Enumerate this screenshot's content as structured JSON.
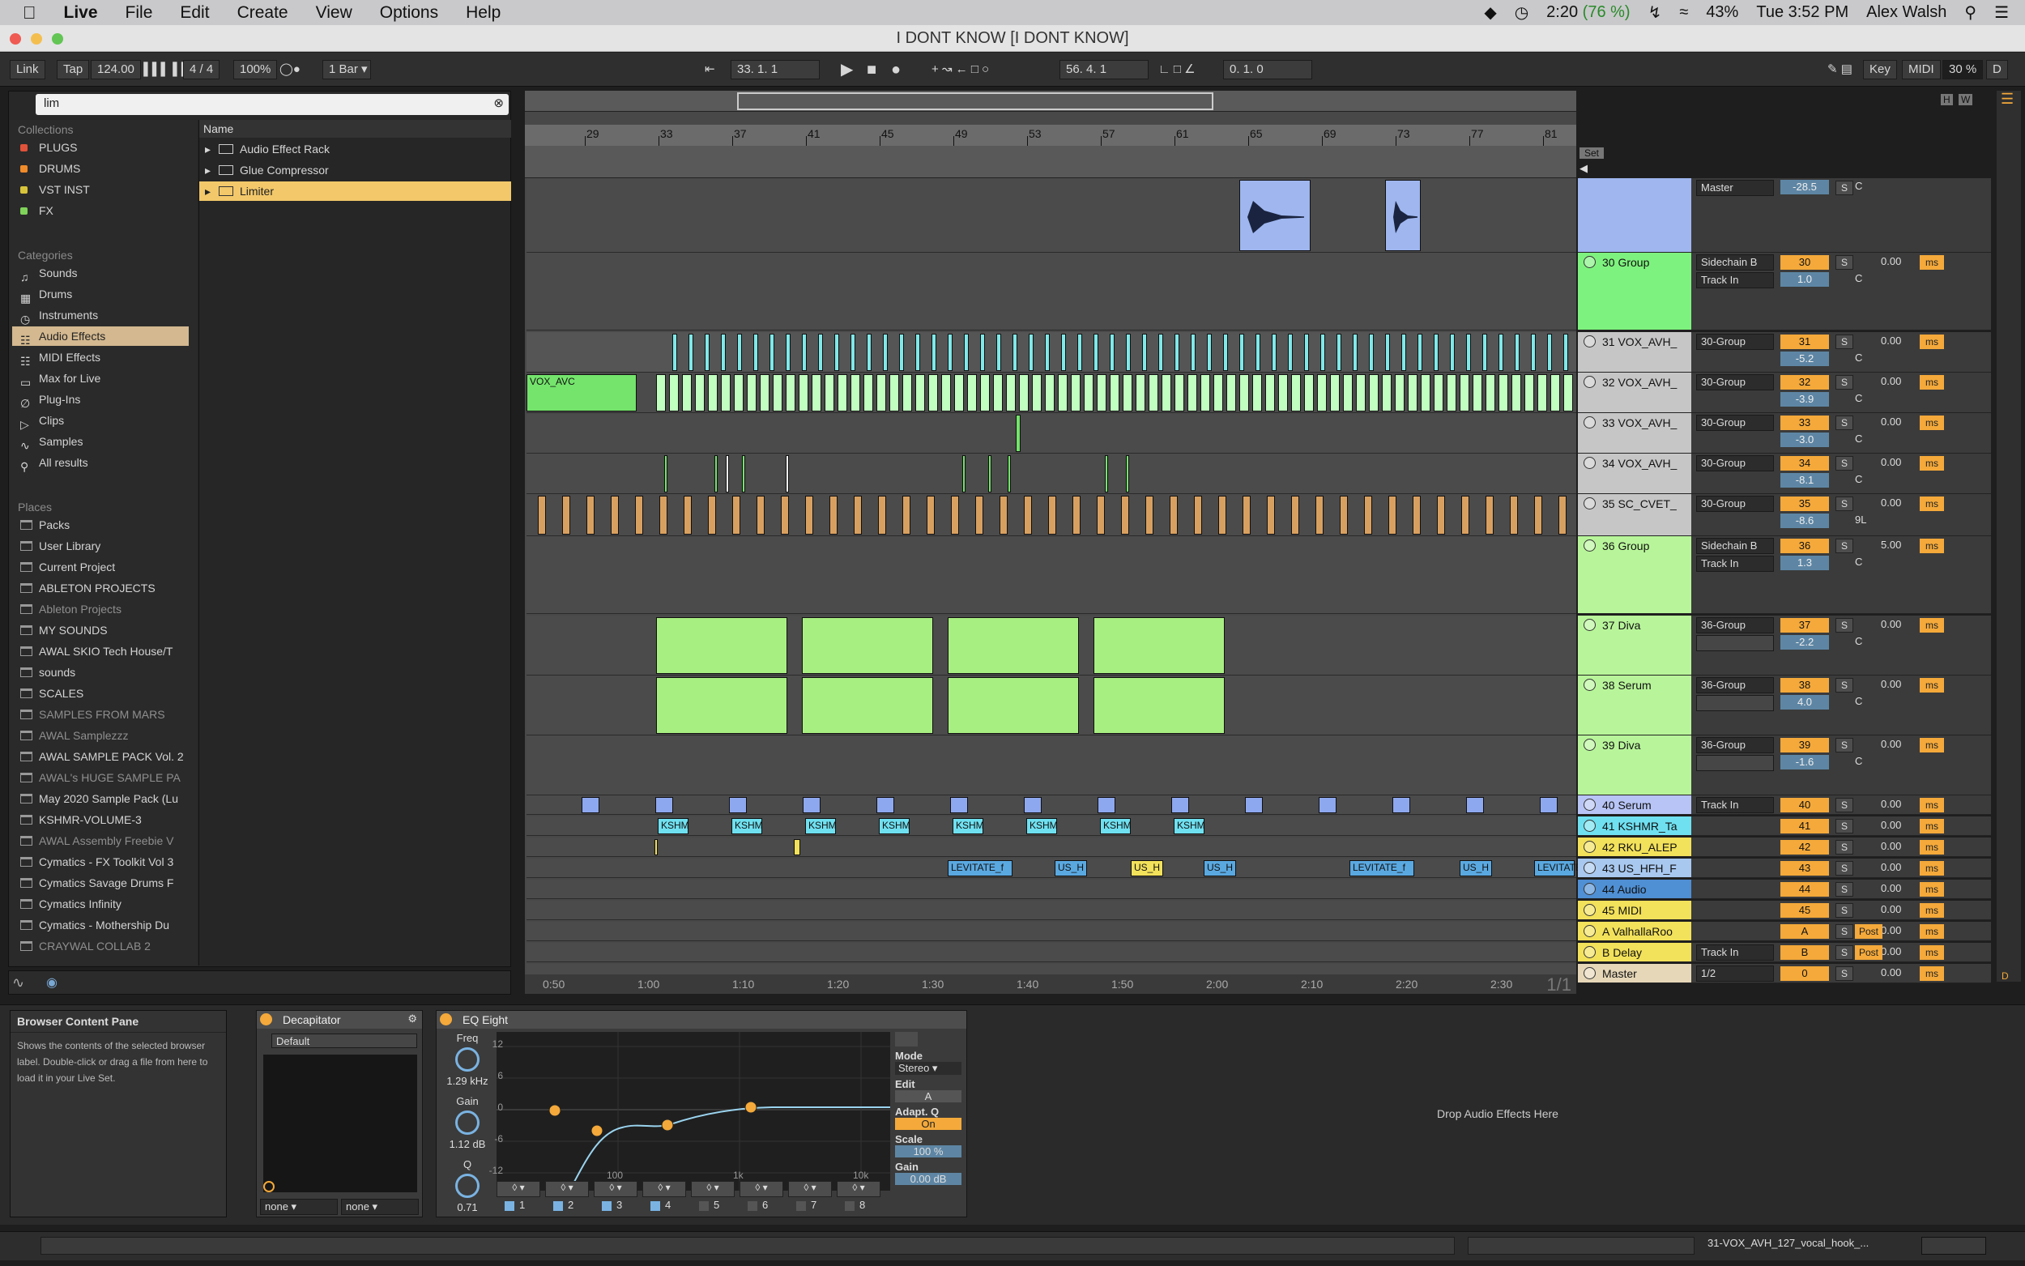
{
  "menubar": {
    "app": "Live",
    "menus": [
      "File",
      "Edit",
      "Create",
      "View",
      "Options",
      "Help"
    ],
    "time_remaining": "2:20",
    "battery_pct": "(76 %)",
    "battery": "43%",
    "clock": "Tue 3:52 PM",
    "user": "Alex Walsh"
  },
  "window": {
    "title": "I DONT KNOW  [I DONT KNOW]"
  },
  "transport": {
    "link": "Link",
    "tap": "Tap",
    "tempo": "124.00",
    "signature": "4 / 4",
    "zoom": "100%",
    "quantize": "1 Bar",
    "position": "33.  1.  1",
    "loop_start": "56.  4.  1",
    "loop_length": "0.  1.  0",
    "key": "Key",
    "midi": "MIDI",
    "cpu": "30 %",
    "d": "D"
  },
  "browser": {
    "search": "lim",
    "collections_header": "Collections",
    "collections": [
      {
        "label": "PLUGS",
        "color": "#e0523a"
      },
      {
        "label": "DRUMS",
        "color": "#f08b2a"
      },
      {
        "label": "VST INST",
        "color": "#d8c43a"
      },
      {
        "label": "FX",
        "color": "#7fd35a"
      }
    ],
    "categories_header": "Categories",
    "categories": [
      "Sounds",
      "Drums",
      "Instruments",
      "Audio Effects",
      "MIDI Effects",
      "Max for Live",
      "Plug-Ins",
      "Clips",
      "Samples",
      "All results"
    ],
    "places_header": "Places",
    "places": [
      "Packs",
      "User Library",
      "Current Project",
      "ABLETON PROJECTS",
      "Ableton Projects",
      "MY SOUNDS",
      "AWAL SKIO Tech House/T",
      "sounds",
      "SCALES",
      "SAMPLES FROM MARS",
      "AWAL Samplezzz",
      "AWAL SAMPLE PACK Vol. 2",
      "AWAL's HUGE SAMPLE PA",
      "May 2020 Sample Pack (Lu",
      "KSHMR-VOLUME-3",
      "AWAL Assembly Freebie V",
      "Cymatics - FX Toolkit Vol 3",
      "Cymatics Savage Drums F",
      "Cymatics Infinity",
      "Cymatics - Mothership Du",
      "CRAYWAL COLLAB 2"
    ],
    "name_header": "Name",
    "results": [
      "Audio Effect Rack",
      "Glue Compressor",
      "Limiter"
    ]
  },
  "ruler": {
    "bars": [
      "29",
      "33",
      "37",
      "41",
      "45",
      "49",
      "53",
      "57",
      "61",
      "65",
      "69",
      "73",
      "77",
      "81"
    ],
    "set": "Set"
  },
  "timeline": {
    "marks": [
      "0:50",
      "1:00",
      "1:10",
      "1:20",
      "1:30",
      "1:40",
      "1:50",
      "2:00",
      "2:10",
      "2:20",
      "2:30"
    ],
    "page": "1/1"
  },
  "tracks": [
    {
      "name": "",
      "num": "",
      "vol": "-28.5",
      "pan": "C",
      "route": "Master",
      "color": "#9fb6ef",
      "in": "1"
    },
    {
      "name": "30 Group",
      "num": "30",
      "vol": "1.0",
      "pan": "C",
      "route": "Sidechain B",
      "sub": "Track In",
      "color": "#7ef27e",
      "send": "0.00"
    },
    {
      "name": "31 VOX_AVH_",
      "num": "31",
      "vol": "-5.2",
      "pan": "C",
      "route": "30-Group",
      "color": "#c6c6c6",
      "send": "0.00"
    },
    {
      "name": "32 VOX_AVH_",
      "num": "32",
      "vol": "-3.9",
      "pan": "C",
      "route": "30-Group",
      "color": "#c6c6c6",
      "send": "0.00"
    },
    {
      "name": "33 VOX_AVH_",
      "num": "33",
      "vol": "-3.0",
      "pan": "C",
      "route": "30-Group",
      "color": "#c6c6c6",
      "send": "0.00"
    },
    {
      "name": "34 VOX_AVH_",
      "num": "34",
      "vol": "-8.1",
      "pan": "C",
      "route": "30-Group",
      "color": "#c6c6c6",
      "send": "0.00"
    },
    {
      "name": "35 SC_CVET_",
      "num": "35",
      "vol": "-8.6",
      "pan": "9L",
      "route": "30-Group",
      "color": "#c6c6c6",
      "send": "0.00"
    },
    {
      "name": "36 Group",
      "num": "36",
      "vol": "1.3",
      "pan": "C",
      "route": "Sidechain B",
      "sub": "Track In",
      "color": "#b8f59a",
      "send": "5.00"
    },
    {
      "name": "37 Diva",
      "num": "37",
      "vol": "-2.2",
      "pan": "C",
      "route": "36-Group",
      "color": "#b8f59a",
      "send": "0.00"
    },
    {
      "name": "38 Serum",
      "num": "38",
      "vol": "4.0",
      "pan": "C",
      "route": "36-Group",
      "color": "#b8f59a",
      "send": "0.00"
    },
    {
      "name": "39 Diva",
      "num": "39",
      "vol": "-1.6",
      "pan": "C",
      "route": "36-Group",
      "color": "#b8f59a",
      "send": "0.00"
    },
    {
      "name": "40 Serum",
      "num": "40",
      "route": "Track In",
      "color": "#b7c4f5",
      "send": "0.00"
    },
    {
      "name": "41 KSHMR_Ta",
      "num": "41",
      "color": "#6fe0f0",
      "send": "0.00"
    },
    {
      "name": "42 RKU_ALEP",
      "num": "42",
      "color": "#f2e15a",
      "send": "0.00"
    },
    {
      "name": "43 US_HFH_F",
      "num": "43",
      "color": "#a8c8ef",
      "send": "0.00"
    },
    {
      "name": "44 Audio",
      "num": "44",
      "color": "#4f8fd4",
      "send": "0.00"
    },
    {
      "name": "45 MIDI",
      "num": "45",
      "color": "#f2e15a",
      "send": "0.00"
    },
    {
      "name": "A ValhallaRoo",
      "num": "A",
      "color": "#f2e15a",
      "send": "0.00",
      "post": "Post"
    },
    {
      "name": "B Delay",
      "num": "B",
      "route": "Track In",
      "color": "#f2e15a",
      "send": "0.00",
      "post": "Post"
    },
    {
      "name": "Master",
      "num": "0",
      "route": "1/2",
      "color": "#e6d7b8",
      "send": "0.00"
    }
  ],
  "clip_labels": {
    "kshmr": "KSHM",
    "levitate": "LEVITATE_f",
    "us": "US_H",
    "vox": "VOX_AVC"
  },
  "info": {
    "title": "Browser Content Pane",
    "body": "Shows the contents of the selected browser label. Double-click or drag a file from here to load it in your Live Set."
  },
  "decapitator": {
    "title": "Decapitator",
    "preset": "Default",
    "sel1": "none",
    "sel2": "none"
  },
  "eq": {
    "title": "EQ Eight",
    "freq_label": "Freq",
    "freq": "1.29 kHz",
    "gain_label": "Gain",
    "gain": "1.12 dB",
    "q_label": "Q",
    "q": "0.71",
    "db_ticks": [
      "12",
      "6",
      "0",
      "-6",
      "-12"
    ],
    "hz_ticks": [
      "100",
      "1k",
      "10k"
    ],
    "mode_label": "Mode",
    "mode": "Stereo",
    "edit_label": "Edit",
    "edit": "A",
    "adapt_label": "Adapt. Q",
    "adapt": "On",
    "scale_label": "Scale",
    "scale": "100 %",
    "out_gain_label": "Gain",
    "out_gain": "0.00 dB",
    "bands": [
      "1",
      "2",
      "3",
      "4",
      "5",
      "6",
      "7",
      "8"
    ]
  },
  "drop_zone": "Drop Audio Effects Here",
  "status": {
    "clip": "31-VOX_AVH_127_vocal_hook_..."
  },
  "colors": {
    "accent": "#f4a93a",
    "selection": "#f2c86a",
    "group_green": "#7ef27e"
  }
}
